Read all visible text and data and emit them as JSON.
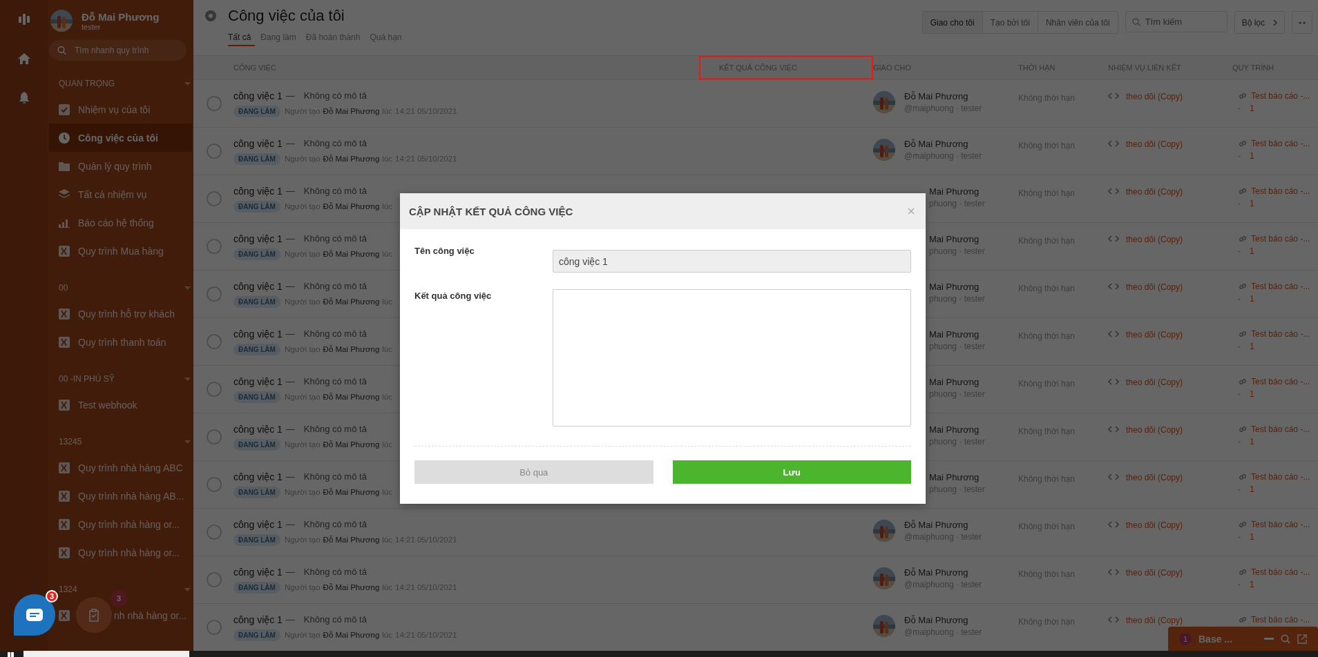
{
  "user": {
    "name": "Đỗ Mai Phương",
    "role": "tester"
  },
  "sidebar": {
    "search": {
      "placeholder": "Tìm nhanh quy trình"
    },
    "groups": [
      {
        "label": "QUAN TRỌNG",
        "items": [
          {
            "label": "Nhiệm vụ của tôi",
            "kind": "tasks",
            "selected": false
          },
          {
            "label": "Công việc của tôi",
            "kind": "clock",
            "selected": true
          },
          {
            "label": "Quản lý quy trình",
            "kind": "folder",
            "selected": false
          },
          {
            "label": "Tất cả nhiệm vụ",
            "kind": "layers",
            "selected": false
          },
          {
            "label": "Báo cáo hệ thống",
            "kind": "chart",
            "selected": false
          },
          {
            "label": "Quy trình Mua hàng",
            "kind": "process",
            "selected": false
          }
        ]
      },
      {
        "label": "00",
        "items": [
          {
            "label": "Quy trình hỗ trợ khách",
            "kind": "process",
            "selected": false
          },
          {
            "label": "Quy trình thanh toán",
            "kind": "process",
            "selected": false
          }
        ]
      },
      {
        "label": "00 -IN PHÚ SỸ",
        "items": [
          {
            "label": "Test webhook",
            "kind": "process",
            "selected": false
          }
        ]
      },
      {
        "label": "13245",
        "items": [
          {
            "label": "Quy trình nhà hàng ABC",
            "kind": "process",
            "selected": false
          },
          {
            "label": "Quy trình nhà hàng AB...",
            "kind": "process",
            "selected": false
          },
          {
            "label": "Quy trình nhà hàng or...",
            "kind": "process",
            "selected": false
          },
          {
            "label": "Quy trình nhà hàng or...",
            "kind": "process",
            "selected": false
          }
        ]
      },
      {
        "label": "1324",
        "items": [
          {
            "label": "nh nhà hàng or...",
            "kind": "process",
            "selected": false
          }
        ]
      }
    ]
  },
  "page": {
    "title": "Công việc của tôi",
    "tabs": [
      {
        "label": "Tất cả",
        "selected": true
      },
      {
        "label": "Đang làm",
        "selected": false
      },
      {
        "label": "Đã hoàn thành",
        "selected": false
      },
      {
        "label": "Quá hạn",
        "selected": false
      }
    ],
    "filters": [
      {
        "label": "Giao cho tôi",
        "selected": true
      },
      {
        "label": "Tạo bởi tôi",
        "selected": false
      },
      {
        "label": "Nhân viên của tôi",
        "selected": false
      }
    ],
    "search": {
      "placeholder": "Tìm kiếm"
    },
    "filter_button": {
      "label": "Bộ lọc"
    }
  },
  "table": {
    "columns": [
      {
        "label": "CÔNG VIỆC",
        "highlighted": false
      },
      {
        "label": "KẾT QUẢ CÔNG VIỆC",
        "highlighted": true
      },
      {
        "label": "GIAO CHO",
        "highlighted": false
      },
      {
        "label": "THỜI HẠN",
        "highlighted": false
      },
      {
        "label": "NHIỆM VỤ LIÊN KẾT",
        "highlighted": false
      },
      {
        "label": "QUY TRÌNH",
        "highlighted": false
      }
    ],
    "rows": [
      {
        "done": false,
        "name": "công việc 1",
        "dash": "—",
        "description": "Không có mô tả",
        "status": "ĐANG LÀM",
        "created_label": "Người tạo",
        "creator": "Đỗ Mai Phương",
        "time_word": "lúc",
        "time": "14:21 05/10/2021",
        "assignee": "Đỗ Mai Phương",
        "handle": "@maiphuong · tester",
        "deadline": "Không thời hạn",
        "linked": "theo dõi (Copy)",
        "process": "Test báo cáo -...",
        "process_dash": "-",
        "process_num": "1"
      },
      {
        "done": false,
        "name": "công việc 1",
        "dash": "—",
        "description": "Không có mô tả",
        "status": "ĐANG LÀM",
        "created_label": "Người tạo",
        "creator": "Đỗ Mai Phương",
        "time_word": "lúc",
        "time": "14:21 05/10/2021",
        "assignee": "Đỗ Mai Phương",
        "handle": "@maiphuong · tester",
        "deadline": "Không thời hạn",
        "linked": "theo dõi (Copy)",
        "process": "Test báo cáo -...",
        "process_dash": "-",
        "process_num": "1"
      },
      {
        "done": false,
        "name": "công việc 1",
        "dash": "—",
        "description": "Không có mô tả",
        "status": "ĐANG LÀM",
        "created_label": "Người tạo",
        "creator": "Đỗ Mai Phương",
        "time_word": "lúc",
        "assignee": "Mai Phương",
        "handle": "phuong · tester",
        "deadline": "Không thời hạn",
        "linked": "theo dõi (Copy)",
        "process": "Test báo cáo -...",
        "process_dash": "-",
        "process_num": "1"
      },
      {
        "done": false,
        "name": "công việc 1",
        "dash": "—",
        "description": "Không có mô tả",
        "status": "ĐANG LÀM",
        "created_label": "Người tạo",
        "creator": "Đỗ Mai Phương",
        "time_word": "lúc",
        "assignee": "Mai Phương",
        "handle": "phuong · tester",
        "deadline": "Không thời hạn",
        "linked": "theo dõi (Copy)",
        "process": "Test báo cáo -...",
        "process_dash": "-",
        "process_num": "1"
      },
      {
        "done": false,
        "name": "công việc 1",
        "dash": "—",
        "description": "Không có mô tả",
        "status": "ĐANG LÀM",
        "created_label": "Người tạo",
        "creator": "Đỗ Mai Phương",
        "time_word": "lúc",
        "assignee": "Mai Phương",
        "handle": "phuong · tester",
        "deadline": "Không thời hạn",
        "linked": "theo dõi (Copy)",
        "process": "Test báo cáo -...",
        "process_dash": "-",
        "process_num": "1"
      },
      {
        "done": false,
        "name": "công việc 1",
        "dash": "—",
        "description": "Không có mô tả",
        "status": "ĐANG LÀM",
        "created_label": "Người tạo",
        "creator": "Đỗ Mai Phương",
        "time_word": "lúc",
        "assignee": "Mai Phương",
        "handle": "phuong · tester",
        "deadline": "Không thời hạn",
        "linked": "theo dõi (Copy)",
        "process": "Test báo cáo -...",
        "process_dash": "-",
        "process_num": "1"
      },
      {
        "done": false,
        "name": "công việc 1",
        "dash": "—",
        "description": "Không có mô tả",
        "status": "ĐANG LÀM",
        "created_label": "Người tạo",
        "creator": "Đỗ Mai Phương",
        "time_word": "lúc",
        "assignee": "Mai Phương",
        "handle": "phuong · tester",
        "deadline": "Không thời hạn",
        "linked": "theo dõi (Copy)",
        "process": "Test báo cáo -...",
        "process_dash": "-",
        "process_num": "1"
      },
      {
        "done": false,
        "name": "công việc 1",
        "dash": "—",
        "description": "Không có mô tả",
        "status": "ĐANG LÀM",
        "created_label": "Người tạo",
        "creator": "Đỗ Mai Phương",
        "time_word": "lúc",
        "assignee": "Mai Phương",
        "handle": "phuong · tester",
        "deadline": "Không thời hạn",
        "linked": "theo dõi (Copy)",
        "process": "Test báo cáo -...",
        "process_dash": "-",
        "process_num": "1"
      },
      {
        "done": false,
        "name": "công việc 1",
        "dash": "—",
        "description": "Không có mô tả",
        "status": "ĐANG LÀM",
        "created_label": "Người tạo",
        "creator": "Đỗ Mai Phương",
        "time_word": "lúc",
        "assignee": "Mai Phương",
        "handle": "phuong · tester",
        "deadline": "Không thời hạn",
        "linked": "theo dõi (Copy)",
        "process": "Test báo cáo -...",
        "process_dash": "-",
        "process_num": "1"
      },
      {
        "done": false,
        "name": "công việc 1",
        "dash": "—",
        "description": "Không có mô tả",
        "status": "ĐANG LÀM",
        "created_label": "Người tạo",
        "creator": "Đỗ Mai Phương",
        "time_word": "lúc",
        "time": "14:21 05/10/2021",
        "assignee": "Đỗ Mai Phương",
        "handle": "@maiphuong · tester",
        "deadline": "Không thời hạn",
        "linked": "theo dõi (Copy)",
        "process": "Test báo cáo -...",
        "process_dash": "-",
        "process_num": "1"
      },
      {
        "done": false,
        "name": "công việc 1",
        "dash": "—",
        "description": "Không có mô tả",
        "status": "ĐANG LÀM",
        "created_label": "Người tạo",
        "creator": "Đỗ Mai Phương",
        "time_word": "lúc",
        "time": "14:21 05/10/2021",
        "assignee": "Đỗ Mai Phương",
        "handle": "@maiphuong · tester",
        "deadline": "Không thời hạn",
        "linked": "theo dõi (Copy)",
        "process": "Test báo cáo -...",
        "process_dash": "-",
        "process_num": "1"
      },
      {
        "done": false,
        "name": "công việc 1",
        "dash": "—",
        "description": "Không có mô tả",
        "status": "ĐANG LÀM",
        "created_label": "Người tạo",
        "creator": "Đỗ Mai Phương",
        "time_word": "lúc",
        "time": "14:21 05/10/2021",
        "assignee": "Đỗ Mai Phương",
        "handle": "@maiphuong · tester",
        "deadline": "Không thời hạn",
        "linked": "theo dõi (Copy)",
        "process": "Test báo cáo -..."
      }
    ]
  },
  "modal": {
    "title": "CẬP NHẬT KẾT QUẢ CÔNG VIỆC",
    "fields": [
      {
        "label": "Tên công việc",
        "kind": "input",
        "value": "công việc 1",
        "disabled": true
      },
      {
        "label": "Kết quả công việc",
        "kind": "textarea",
        "disabled": false
      }
    ],
    "buttons": [
      {
        "label": "Bỏ qua",
        "kind": "secondary"
      },
      {
        "label": "Lưu",
        "kind": "primary"
      }
    ]
  },
  "chat_fab": {
    "badge": "3"
  },
  "tasks_fab": {
    "badge": "3"
  },
  "chat_widget": {
    "badge": "1",
    "title": "Base ..."
  }
}
